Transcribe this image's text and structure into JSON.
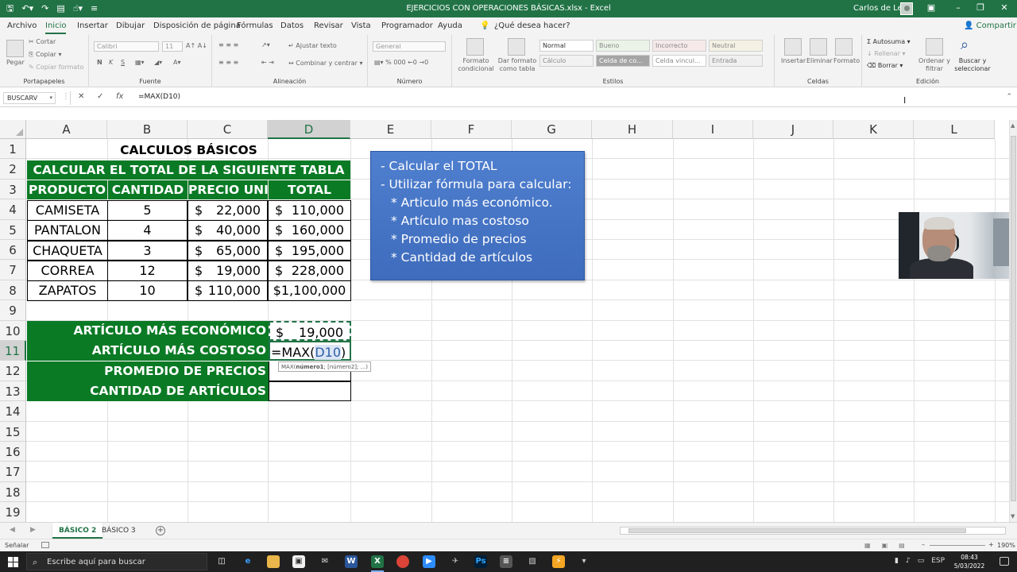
{
  "titlebar": {
    "document_title": "EJERCICIOS CON OPERACIONES BÁSICAS.xlsx - Excel",
    "user_name": "Carlos de Leon",
    "icons": [
      "save-icon",
      "undo-icon",
      "redo-icon",
      "touch-mode-icon",
      "customize-qat-icon",
      "ribbon-display-icon",
      "minimize-icon",
      "restore-icon",
      "close-icon"
    ]
  },
  "ribbon_tabs": {
    "archivo": "Archivo",
    "inicio": "Inicio",
    "insertar": "Insertar",
    "dibujar": "Dibujar",
    "disposicion": "Disposición de página",
    "formulas": "Fórmulas",
    "datos": "Datos",
    "revisar": "Revisar",
    "vista": "Vista",
    "programador": "Programador",
    "ayuda": "Ayuda",
    "tell_me": "¿Qué desea hacer?",
    "share": "Compartir"
  },
  "ribbon": {
    "clipboard": {
      "label": "Portapapeles",
      "paste": "Pegar",
      "cut": "Cortar",
      "copy": "Copiar",
      "format_painter": "Copiar formato"
    },
    "font": {
      "label": "Fuente",
      "name": "Calibri",
      "size": "11",
      "bold": "N",
      "italic": "K",
      "underline": "S"
    },
    "alignment": {
      "label": "Alineación",
      "wrap": "Ajustar texto",
      "merge": "Combinar y centrar"
    },
    "number": {
      "label": "Número",
      "format": "General"
    },
    "styles": {
      "label": "Estilos",
      "conditional": "Formato condicional",
      "as_table": "Dar formato como tabla",
      "cells": [
        "Normal",
        "Bueno",
        "Incorrecto",
        "Neutral",
        "Cálculo",
        "Celda de co...",
        "Celda vincul...",
        "Entrada"
      ]
    },
    "cells": {
      "label": "Celdas",
      "insert": "Insertar",
      "delete": "Eliminar",
      "format": "Formato"
    },
    "editing": {
      "label": "Edición",
      "autosum": "Autosuma",
      "fill": "Rellenar",
      "clear": "Borrar",
      "sort": "Ordenar y filtrar",
      "find": "Buscar y seleccionar"
    }
  },
  "formula_bar": {
    "name_box": "BUSCARV",
    "formula": "=MAX(D10)"
  },
  "columns": [
    "A",
    "B",
    "C",
    "D",
    "E",
    "F",
    "G",
    "H",
    "I",
    "J",
    "K",
    "L"
  ],
  "selected_column": "D",
  "rows": [
    "1",
    "2",
    "3",
    "4",
    "5",
    "6",
    "7",
    "8",
    "9",
    "10",
    "11",
    "12",
    "13",
    "14",
    "15",
    "16",
    "17",
    "18",
    "19"
  ],
  "selected_row": "11",
  "sheet": {
    "title": "CALCULOS BÁSICOS",
    "subtitle": "CALCULAR EL TOTAL DE LA SIGUIENTE TABLA",
    "headers": [
      "PRODUCTO",
      "CANTIDAD",
      "PRECIO UNI.",
      "TOTAL"
    ],
    "currency": "$",
    "items": [
      {
        "product": "CAMISETA",
        "qty": "5",
        "price": "22,000",
        "total": "110,000"
      },
      {
        "product": "PANTALON",
        "qty": "4",
        "price": "40,000",
        "total": "160,000"
      },
      {
        "product": "CHAQUETA",
        "qty": "3",
        "price": "65,000",
        "total": "195,000"
      },
      {
        "product": "CORREA",
        "qty": "12",
        "price": "19,000",
        "total": "228,000"
      },
      {
        "product": "ZAPATOS",
        "qty": "10",
        "price": "110,000",
        "total": "$1,100,000"
      }
    ],
    "summary": {
      "cheapest_label": "ARTÍCULO MÁS ECONÓMICO",
      "cheapest_value": "19,000",
      "costliest_label": "ARTÍCULO MÁS COSTOSO",
      "editing_formula_prefix": "=MAX(",
      "editing_formula_ref": "D10",
      "editing_formula_suffix": ")",
      "avg_label": "PROMEDIO DE PRECIOS",
      "count_label": "CANTIDAD DE ARTÍCULOS"
    },
    "tooltip": {
      "fn": "MAX(",
      "arg1": "número1",
      "rest": "; [número2]; ...)"
    }
  },
  "textbox": {
    "lines": [
      "- Calcular el TOTAL",
      "- Utilizar fórmula para calcular:",
      "* Articulo más económico.",
      "* Artículo mas costoso",
      "* Promedio de precios",
      "* Cantidad de artículos"
    ]
  },
  "sheet_tabs": {
    "active": "BÁSICO 2",
    "other": "BÁSICO 3"
  },
  "status": {
    "mode": "Señalar",
    "zoom": "190%"
  },
  "taskbar": {
    "search_placeholder": "Escribe aquí para buscar",
    "lang": "ESP",
    "time": "08:43",
    "date": "5/03/2022"
  }
}
